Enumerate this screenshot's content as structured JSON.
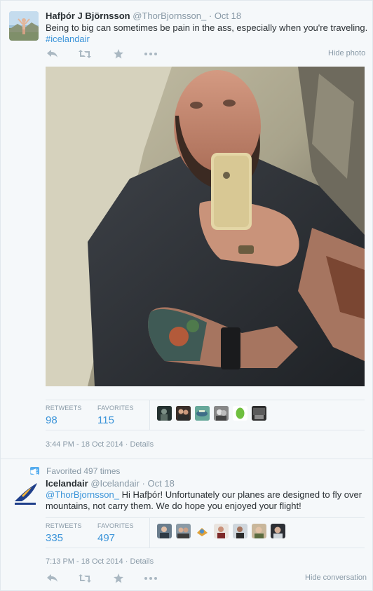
{
  "colors": {
    "link": "#3b94d9",
    "muted": "#8899a6",
    "background": "#f5f8fa",
    "border": "#e1e8ed"
  },
  "tweet1": {
    "fullname": "Hafþór J Björnsson",
    "handle": "@ThorBjornsson_",
    "separator": "·",
    "date": "Oct 18",
    "text": "Being to big can sometimes be pain in the ass, especially when you're traveling.",
    "hashtag": "#icelandair",
    "hide_label": "Hide photo",
    "photo_alt": "selfie-photo",
    "stats": {
      "retweets_label": "RETWEETS",
      "retweets": "98",
      "favorites_label": "FAVORITES",
      "favorites": "115"
    },
    "faces": [
      "avatar-1",
      "avatar-2",
      "avatar-3",
      "avatar-4",
      "avatar-5",
      "avatar-6"
    ],
    "timestamp": "3:44 PM - 18 Oct 2014",
    "meta_separator": "·",
    "details": "Details"
  },
  "tweet2": {
    "favorited": "Favorited 497 times",
    "fullname": "Icelandair",
    "handle": "@Icelandair",
    "separator": "·",
    "date": "Oct 18",
    "mention": "@ThorBjornsson_",
    "text": " Hi Hafþór! Unfortunately our planes are designed to fly over mountains, not carry them. We do hope you enjoyed your flight!",
    "stats": {
      "retweets_label": "RETWEETS",
      "retweets": "335",
      "favorites_label": "FAVORITES",
      "favorites": "497"
    },
    "faces": [
      "avatar-1",
      "avatar-2",
      "avatar-3",
      "avatar-4",
      "avatar-5",
      "avatar-6",
      "avatar-7"
    ],
    "timestamp": "7:13 PM - 18 Oct 2014",
    "meta_separator": "·",
    "details": "Details",
    "hide_label": "Hide conversation",
    "logo_text": "ICELANDAIR"
  },
  "icons": [
    "reply-icon",
    "retweet-icon",
    "favorite-icon",
    "more-icon"
  ]
}
